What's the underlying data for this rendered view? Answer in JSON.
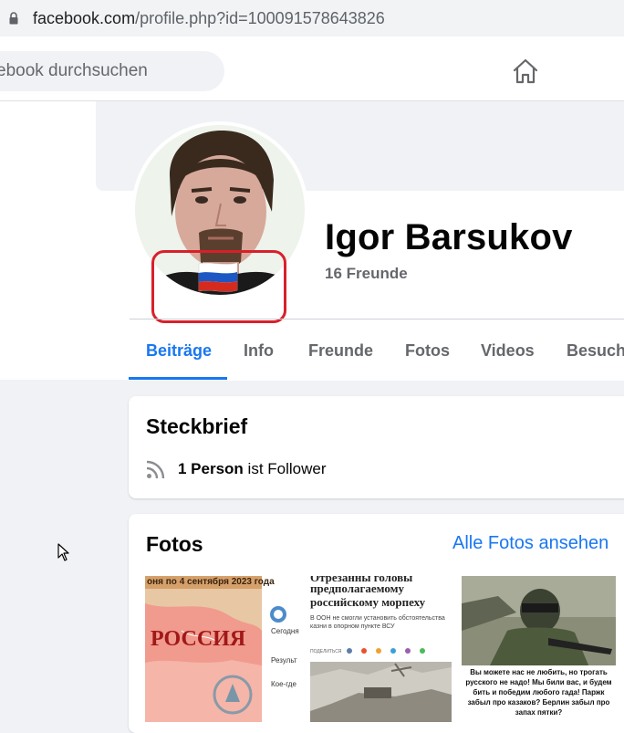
{
  "browser": {
    "url_host": "facebook.com",
    "url_path": "/profile.php?id=100091578643826"
  },
  "nav": {
    "search_placeholder": "ebook durchsuchen"
  },
  "profile": {
    "name": "Igor Barsukov",
    "friends": "16 Freunde"
  },
  "tabs": [
    "Beiträge",
    "Info",
    "Freunde",
    "Fotos",
    "Videos",
    "Besuche"
  ],
  "steckbrief": {
    "title": "Steckbrief",
    "follower_count": "1 Person",
    "follower_suffix": " ist Follower"
  },
  "fotos": {
    "title": "Fotos",
    "see_all": "Alle Fotos ansehen",
    "photo1": {
      "banner": "оня по 4 сентября 2023 года",
      "map_text": "РОССИЯ",
      "side_lines": [
        "Сегодня",
        "Результ",
        "Кое-где"
      ]
    },
    "photo2": {
      "headline_top": "Отрезанны головы",
      "headline": "предполагаемому российскому морпеху",
      "caption": "В ООН не смогли установить обстоятельства казни в опорном пункте ВСУ",
      "share_label": "ПОДЕЛИТЬСЯ"
    },
    "photo3": {
      "caption": "Вы можете нас не любить, но трогать русского не надо! Мы били вас, и будем бить и победим любого гада! Паржк забыл про казаков? Берлин забыл про запах пятки?"
    }
  },
  "colors": {
    "accent": "#1877f2",
    "highlight_box": "#d9202a",
    "muted_text": "#65676b"
  },
  "icons": {
    "lock": "lock-icon",
    "home": "home-icon",
    "rss": "rss-icon",
    "cursor": "mouse-cursor-icon",
    "flag": "russian-flag-icon"
  }
}
